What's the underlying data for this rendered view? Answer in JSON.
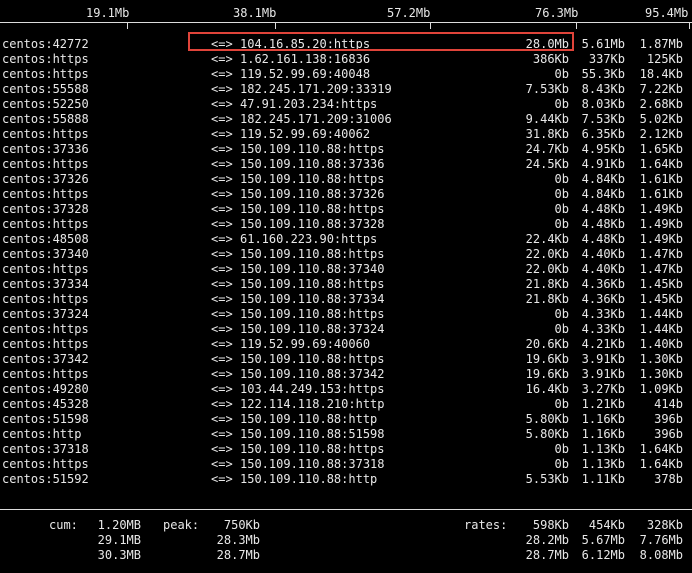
{
  "scale": {
    "labels": [
      "19.1Mb",
      "38.1Mb",
      "57.2Mb",
      "76.3Mb",
      "95.4Mb"
    ]
  },
  "connections": [
    {
      "src": "centos:42772",
      "dir": "<=>",
      "dst": "104.16.85.20:https",
      "r1": "28.0Mb",
      "r2": "5.61Mb",
      "r3": "1.87Mb"
    },
    {
      "src": "centos:https",
      "dir": "<=>",
      "dst": "1.62.161.138:16836",
      "r1": "386Kb",
      "r2": "337Kb",
      "r3": "125Kb"
    },
    {
      "src": "centos:https",
      "dir": "<=>",
      "dst": "119.52.99.69:40048",
      "r1": "0b",
      "r2": "55.3Kb",
      "r3": "18.4Kb"
    },
    {
      "src": "centos:55588",
      "dir": "<=>",
      "dst": "182.245.171.209:33319",
      "r1": "7.53Kb",
      "r2": "8.43Kb",
      "r3": "7.22Kb"
    },
    {
      "src": "centos:52250",
      "dir": "<=>",
      "dst": "47.91.203.234:https",
      "r1": "0b",
      "r2": "8.03Kb",
      "r3": "2.68Kb"
    },
    {
      "src": "centos:55888",
      "dir": "<=>",
      "dst": "182.245.171.209:31006",
      "r1": "9.44Kb",
      "r2": "7.53Kb",
      "r3": "5.02Kb"
    },
    {
      "src": "centos:https",
      "dir": "<=>",
      "dst": "119.52.99.69:40062",
      "r1": "31.8Kb",
      "r2": "6.35Kb",
      "r3": "2.12Kb"
    },
    {
      "src": "centos:37336",
      "dir": "<=>",
      "dst": "150.109.110.88:https",
      "r1": "24.7Kb",
      "r2": "4.95Kb",
      "r3": "1.65Kb"
    },
    {
      "src": "centos:https",
      "dir": "<=>",
      "dst": "150.109.110.88:37336",
      "r1": "24.5Kb",
      "r2": "4.91Kb",
      "r3": "1.64Kb"
    },
    {
      "src": "centos:37326",
      "dir": "<=>",
      "dst": "150.109.110.88:https",
      "r1": "0b",
      "r2": "4.84Kb",
      "r3": "1.61Kb"
    },
    {
      "src": "centos:https",
      "dir": "<=>",
      "dst": "150.109.110.88:37326",
      "r1": "0b",
      "r2": "4.84Kb",
      "r3": "1.61Kb"
    },
    {
      "src": "centos:37328",
      "dir": "<=>",
      "dst": "150.109.110.88:https",
      "r1": "0b",
      "r2": "4.48Kb",
      "r3": "1.49Kb"
    },
    {
      "src": "centos:https",
      "dir": "<=>",
      "dst": "150.109.110.88:37328",
      "r1": "0b",
      "r2": "4.48Kb",
      "r3": "1.49Kb"
    },
    {
      "src": "centos:48508",
      "dir": "<=>",
      "dst": "61.160.223.90:https",
      "r1": "22.4Kb",
      "r2": "4.48Kb",
      "r3": "1.49Kb"
    },
    {
      "src": "centos:37340",
      "dir": "<=>",
      "dst": "150.109.110.88:https",
      "r1": "22.0Kb",
      "r2": "4.40Kb",
      "r3": "1.47Kb"
    },
    {
      "src": "centos:https",
      "dir": "<=>",
      "dst": "150.109.110.88:37340",
      "r1": "22.0Kb",
      "r2": "4.40Kb",
      "r3": "1.47Kb"
    },
    {
      "src": "centos:37334",
      "dir": "<=>",
      "dst": "150.109.110.88:https",
      "r1": "21.8Kb",
      "r2": "4.36Kb",
      "r3": "1.45Kb"
    },
    {
      "src": "centos:https",
      "dir": "<=>",
      "dst": "150.109.110.88:37334",
      "r1": "21.8Kb",
      "r2": "4.36Kb",
      "r3": "1.45Kb"
    },
    {
      "src": "centos:37324",
      "dir": "<=>",
      "dst": "150.109.110.88:https",
      "r1": "0b",
      "r2": "4.33Kb",
      "r3": "1.44Kb"
    },
    {
      "src": "centos:https",
      "dir": "<=>",
      "dst": "150.109.110.88:37324",
      "r1": "0b",
      "r2": "4.33Kb",
      "r3": "1.44Kb"
    },
    {
      "src": "centos:https",
      "dir": "<=>",
      "dst": "119.52.99.69:40060",
      "r1": "20.6Kb",
      "r2": "4.21Kb",
      "r3": "1.40Kb"
    },
    {
      "src": "centos:37342",
      "dir": "<=>",
      "dst": "150.109.110.88:https",
      "r1": "19.6Kb",
      "r2": "3.91Kb",
      "r3": "1.30Kb"
    },
    {
      "src": "centos:https",
      "dir": "<=>",
      "dst": "150.109.110.88:37342",
      "r1": "19.6Kb",
      "r2": "3.91Kb",
      "r3": "1.30Kb"
    },
    {
      "src": "centos:49280",
      "dir": "<=>",
      "dst": "103.44.249.153:https",
      "r1": "16.4Kb",
      "r2": "3.27Kb",
      "r3": "1.09Kb"
    },
    {
      "src": "centos:45328",
      "dir": "<=>",
      "dst": "122.114.118.210:http",
      "r1": "0b",
      "r2": "1.21Kb",
      "r3": "414b"
    },
    {
      "src": "centos:51598",
      "dir": "<=>",
      "dst": "150.109.110.88:http",
      "r1": "5.80Kb",
      "r2": "1.16Kb",
      "r3": "396b"
    },
    {
      "src": "centos:http",
      "dir": "<=>",
      "dst": "150.109.110.88:51598",
      "r1": "5.80Kb",
      "r2": "1.16Kb",
      "r3": "396b"
    },
    {
      "src": "centos:37318",
      "dir": "<=>",
      "dst": "150.109.110.88:https",
      "r1": "0b",
      "r2": "1.13Kb",
      "r3": "1.64Kb"
    },
    {
      "src": "centos:https",
      "dir": "<=>",
      "dst": "150.109.110.88:37318",
      "r1": "0b",
      "r2": "1.13Kb",
      "r3": "1.64Kb"
    },
    {
      "src": "centos:51592",
      "dir": "<=>",
      "dst": "150.109.110.88:http",
      "r1": "5.53Kb",
      "r2": "1.11Kb",
      "r3": "378b"
    }
  ],
  "footer": {
    "cum_label": "cum:",
    "peak_label": "peak:",
    "rates_label": "rates:",
    "rows": [
      {
        "cum": "1.20MB",
        "peak": "750Kb",
        "r1": "598Kb",
        "r2": "454Kb",
        "r3": "328Kb"
      },
      {
        "cum": "29.1MB",
        "peak": "28.3Mb",
        "r1": "28.2Mb",
        "r2": "5.67Mb",
        "r3": "7.76Mb"
      },
      {
        "cum": "30.3MB",
        "peak": "28.7Mb",
        "r1": "28.7Mb",
        "r2": "6.12Mb",
        "r3": "8.08Mb"
      }
    ]
  },
  "colors": {
    "background": "#000000",
    "text": "#e8e8e8",
    "highlight": "#e0443a"
  }
}
